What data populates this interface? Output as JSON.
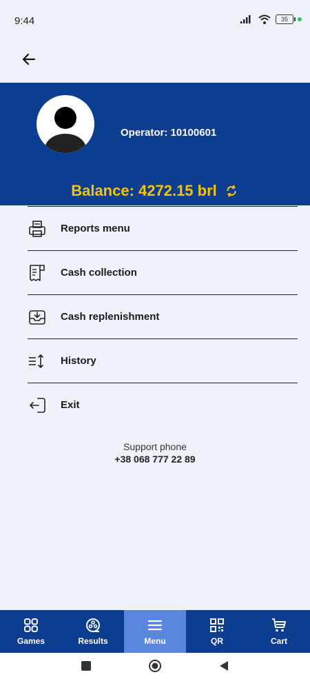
{
  "status": {
    "time": "9:44",
    "battery": "35"
  },
  "profile": {
    "operator_label": "Operator: 10100601",
    "balance_label": "Balance: 4272.15 brl"
  },
  "menu": {
    "items": [
      {
        "label": "Reports menu",
        "icon": "printer-icon"
      },
      {
        "label": "Cash collection",
        "icon": "receipt-icon"
      },
      {
        "label": "Cash replenishment",
        "icon": "inbox-download-icon"
      },
      {
        "label": "History",
        "icon": "list-sort-icon"
      },
      {
        "label": "Exit",
        "icon": "exit-door-icon"
      }
    ]
  },
  "support": {
    "title": "Support phone",
    "phone": "+38 068 777 22 89"
  },
  "bottom_nav": {
    "items": [
      {
        "label": "Games",
        "icon": "grid-icon"
      },
      {
        "label": "Results",
        "icon": "film-reel-icon"
      },
      {
        "label": "Menu",
        "icon": "hamburger-icon"
      },
      {
        "label": "QR",
        "icon": "qr-code-icon"
      },
      {
        "label": "Cart",
        "icon": "cart-icon"
      }
    ],
    "active": "Menu"
  },
  "colors": {
    "header_bg": "#0d3d8f",
    "balance": "#f7c400",
    "active_tab": "#5a86dd",
    "page_bg": "#eef3fb"
  }
}
